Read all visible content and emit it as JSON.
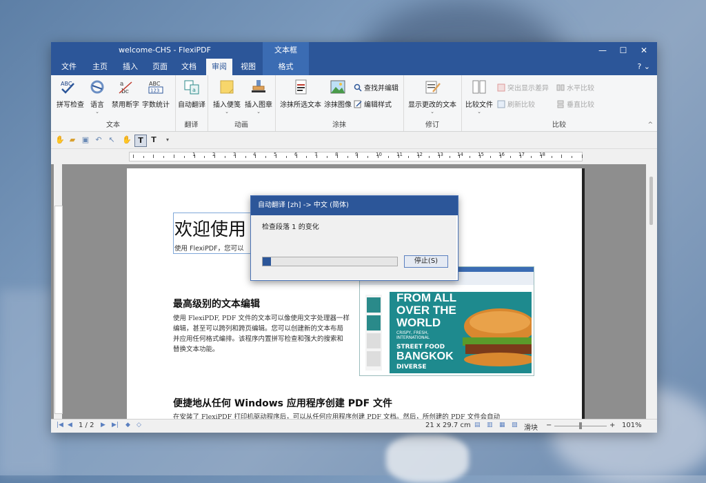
{
  "window": {
    "title": "welcome-CHS - FlexiPDF",
    "context_tab_title": "文本框",
    "controls": {
      "minimize": "—",
      "maximize": "☐",
      "close": "✕"
    },
    "help": "? ⌄"
  },
  "tabs": [
    {
      "label": "文件"
    },
    {
      "label": "主页"
    },
    {
      "label": "插入"
    },
    {
      "label": "页面"
    },
    {
      "label": "文档"
    },
    {
      "label": "审阅",
      "active": true
    },
    {
      "label": "视图"
    },
    {
      "label": "格式",
      "context": true
    }
  ],
  "ribbon": {
    "groups": {
      "text": "文本",
      "translate": "翻译",
      "annotate": "动画",
      "redact": "涂抹",
      "revise": "修订",
      "compare": "比较"
    },
    "buttons": {
      "spellcheck": "拼写检查",
      "language": "语言",
      "no_hyphen": "禁用断字",
      "word_count": "字数统计",
      "auto_translate": "自动翻译",
      "insert_note": "插入便笺",
      "insert_stamp": "插入图章",
      "redact_text": "涂抹所选文本",
      "redact_image": "涂抹图像",
      "find_redact": "查找并编辑",
      "edit_style": "编辑样式",
      "show_changes": "显示更改的文本",
      "compare_files": "比较文件",
      "highlight_diff": "突出显示差异",
      "refresh_compare": "刷新比较",
      "horizontal_compare": "水平比较",
      "vertical_compare": "垂直比较"
    },
    "icon_texts": {
      "abc": "ABC",
      "abc2": "ABC",
      "count": "123",
      "a": "a",
      "bc": "bc"
    }
  },
  "quick_toolbar": {
    "text_tool": "T",
    "text_tool2": "T"
  },
  "ruler": {
    "labels": [
      "1",
      "2",
      "3",
      "4",
      "5",
      "6",
      "7",
      "8",
      "9",
      "10",
      "11",
      "12",
      "13",
      "14",
      "15",
      "16",
      "17",
      "18"
    ]
  },
  "document": {
    "heading": "欢迎使用",
    "subtitle": "使用 FlexiPDF，您可以",
    "section1_title": "最高级别的文本编辑",
    "section1_body": "使用 FlexiPDF, PDF 文件的文本可以像使用文字处理器一样编辑，甚至可以跨列和跨页编辑。您可以创建新的文本布局并应用任何格式编排。该程序内置拼写检查和强大的搜索和替换文本功能。",
    "section2_title": "便捷地从任何 Windows 应用程序创建 PDF 文件",
    "section2_body": "在安装了 FlexiPDF 打印机驱动程序后，可以从任何应用程序创建 PDF 文档。然后，所创建的 PDF 文件会自动",
    "screenshot_cover": {
      "line1": "FROM ALL",
      "line2": "OVER THE",
      "line3": "WORLD",
      "tagline1": "CRISPY, FRESH,",
      "tagline2": "INTERNATIONAL",
      "street": "STREET FOOD",
      "city": "BANGKOK",
      "diverse": "DIVERSE"
    }
  },
  "status": {
    "page": "1 / 2",
    "paper_size": "21 x 29.7 cm",
    "slider_label": "滑块",
    "zoom_minus": "−",
    "zoom_plus": "+",
    "zoom": "101%",
    "zoom_level": 0.5
  },
  "dialog": {
    "title": "自动翻译 [zh] -> 中文 (简体)",
    "message": "检查段落 1 的变化",
    "progress": 0.06,
    "stop_button": "停止(S)"
  }
}
